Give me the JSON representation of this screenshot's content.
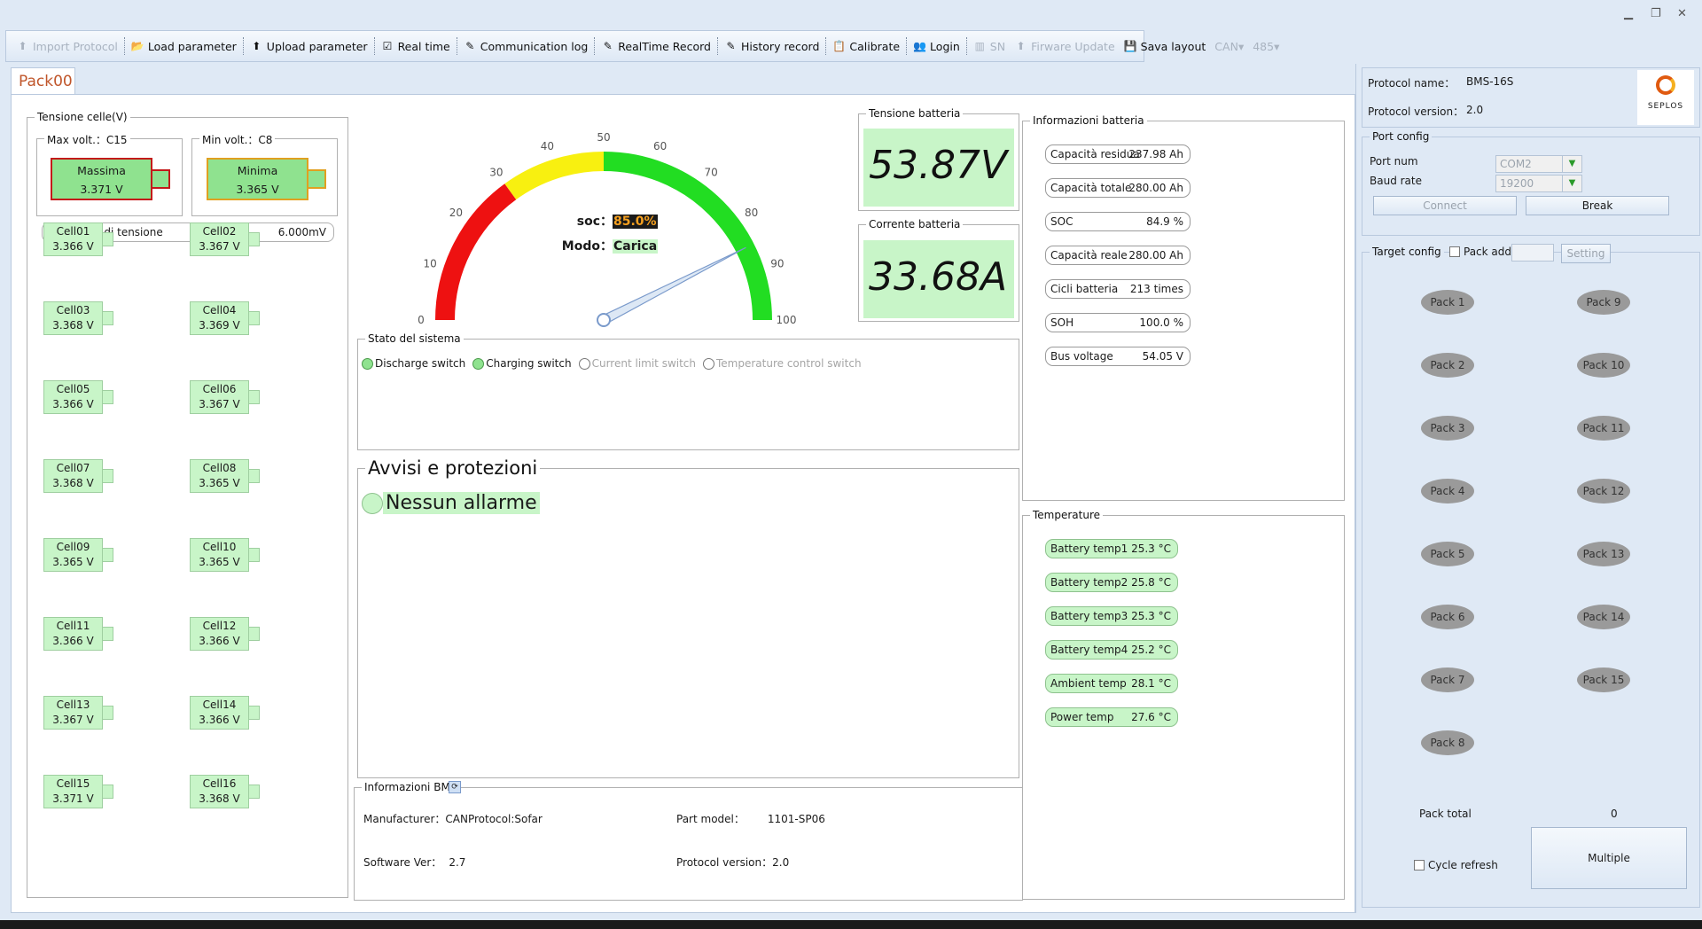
{
  "window": {
    "minimize": "▁",
    "restore": "❐",
    "close": "✕"
  },
  "toolbar": {
    "items": [
      {
        "label": "Import Protocol",
        "icon": "import-icon",
        "disabled": true
      },
      {
        "label": "Load parameter",
        "icon": "load-icon",
        "disabled": false
      },
      {
        "label": "Upload parameter",
        "icon": "upload-icon",
        "disabled": false
      },
      {
        "label": "Real time",
        "icon": "check-icon",
        "disabled": false
      },
      {
        "label": "Communication log",
        "icon": "log-icon",
        "disabled": false
      },
      {
        "label": "RealTime Record",
        "icon": "record-icon",
        "disabled": false
      },
      {
        "label": "History record",
        "icon": "history-icon",
        "disabled": false
      },
      {
        "label": "Calibrate",
        "icon": "calibrate-icon",
        "disabled": false
      },
      {
        "label": "Login",
        "icon": "login-icon",
        "disabled": false
      },
      {
        "label": "SN",
        "icon": "barcode-icon",
        "disabled": true
      },
      {
        "label": "Firware Update",
        "icon": "firmware-icon",
        "disabled": true
      },
      {
        "label": "Sava layout",
        "icon": "save-icon",
        "disabled": false
      },
      {
        "label": "CAN",
        "icon": "",
        "disabled": true
      },
      {
        "label": "485",
        "icon": "",
        "disabled": true
      }
    ]
  },
  "tab": {
    "label": "Pack00"
  },
  "cells_group": {
    "title": "Tensione celle(V)",
    "max": {
      "title": "Max volt.：C15",
      "label": "Massima",
      "value": "3.371 V"
    },
    "min": {
      "title": "Min volt.：C8",
      "label": "Minima",
      "value": "3.365 V"
    },
    "diff_label": "Differenza di tensione",
    "diff_value": "6.000mV",
    "cells": [
      {
        "name": "Cell01",
        "value": "3.366 V"
      },
      {
        "name": "Cell02",
        "value": "3.367 V"
      },
      {
        "name": "Cell03",
        "value": "3.368 V"
      },
      {
        "name": "Cell04",
        "value": "3.369 V"
      },
      {
        "name": "Cell05",
        "value": "3.366 V"
      },
      {
        "name": "Cell06",
        "value": "3.367 V"
      },
      {
        "name": "Cell07",
        "value": "3.368 V"
      },
      {
        "name": "Cell08",
        "value": "3.365 V"
      },
      {
        "name": "Cell09",
        "value": "3.365 V"
      },
      {
        "name": "Cell10",
        "value": "3.365 V"
      },
      {
        "name": "Cell11",
        "value": "3.366 V"
      },
      {
        "name": "Cell12",
        "value": "3.366 V"
      },
      {
        "name": "Cell13",
        "value": "3.367 V"
      },
      {
        "name": "Cell14",
        "value": "3.366 V"
      },
      {
        "name": "Cell15",
        "value": "3.371 V"
      },
      {
        "name": "Cell16",
        "value": "3.368 V"
      }
    ]
  },
  "gauge": {
    "ticks": [
      "0",
      "10",
      "20",
      "30",
      "40",
      "50",
      "60",
      "70",
      "80",
      "90",
      "100"
    ],
    "min": 0,
    "max": 100,
    "needle_value": 85,
    "soc_label": "soc：",
    "soc_value": "85.0%",
    "mode_label": "Modo：",
    "mode_value": "Carica",
    "colors": {
      "red": "#ee1111",
      "yellow": "#f8f010",
      "green": "#22dd22"
    }
  },
  "voltage": {
    "title": "Tensione batteria",
    "value": "53.87V"
  },
  "current": {
    "title": "Corrente batteria",
    "value": "33.68A"
  },
  "system_state": {
    "title": "Stato del sistema",
    "switches": [
      {
        "label": "Discharge switch",
        "on": true
      },
      {
        "label": "Charging switch",
        "on": true
      },
      {
        "label": "Current limit switch",
        "on": false
      },
      {
        "label": "Temperature control switch",
        "on": false
      }
    ]
  },
  "alarms": {
    "title": "Avvisi e protezioni",
    "message": "Nessun allarme"
  },
  "bms_info": {
    "title": "Informazioni BMS",
    "manufacturer_label": "Manufacturer：",
    "manufacturer_value": "CANProtocol:Sofar",
    "part_label": "Part model：",
    "part_value": "1101-SP06",
    "software_label": "Software Ver：",
    "software_value": "2.7",
    "protocol_label": "Protocol version：",
    "protocol_value": "2.0"
  },
  "battery_info": {
    "title": "Informazioni batteria",
    "items": [
      {
        "label": "Capacità residua",
        "value": "237.98 Ah"
      },
      {
        "label": "Capacità totale",
        "value": "280.00 Ah"
      },
      {
        "label": "SOC",
        "value": "84.9 %"
      },
      {
        "label": "Capacità reale",
        "value": "280.00 Ah"
      },
      {
        "label": "Cicli batteria",
        "value": "213 times"
      },
      {
        "label": "SOH",
        "value": "100.0 %"
      },
      {
        "label": "Bus voltage",
        "value": "54.05 V"
      }
    ]
  },
  "temperature": {
    "title": "Temperature",
    "items": [
      {
        "label": "Battery temp1",
        "value": "25.3 °C"
      },
      {
        "label": "Battery temp2",
        "value": "25.8 °C"
      },
      {
        "label": "Battery temp3",
        "value": "25.3 °C"
      },
      {
        "label": "Battery temp4",
        "value": "25.2 °C"
      },
      {
        "label": "Ambient temp",
        "value": "28.1 °C"
      },
      {
        "label": "Power temp",
        "value": "27.6 °C"
      }
    ]
  },
  "right_panel": {
    "protocol_name_label": "Protocol name：",
    "protocol_name_value": "BMS-16S",
    "protocol_version_label": "Protocol version：",
    "protocol_version_value": "2.0",
    "logo_text": "SEPLOS",
    "port_config_title": "Port config",
    "port_num_label": "Port num",
    "port_num_value": "COM2",
    "baud_label": "Baud rate",
    "baud_value": "19200",
    "connect_label": "Connect",
    "break_label": "Break",
    "target_title": "Target config",
    "pack_addr_label": "Pack addr",
    "setting_label": "Setting",
    "packs_left": [
      "Pack 1",
      "Pack 2",
      "Pack 3",
      "Pack 4",
      "Pack 5",
      "Pack 6",
      "Pack 7",
      "Pack 8"
    ],
    "packs_right": [
      "Pack 9",
      "Pack 10",
      "Pack 11",
      "Pack 12",
      "Pack 13",
      "Pack 14",
      "Pack 15"
    ],
    "pack_total_label": "Pack total",
    "pack_total_value": "0",
    "cycle_refresh_label": "Cycle refresh",
    "multiple_label": "Multiple"
  }
}
